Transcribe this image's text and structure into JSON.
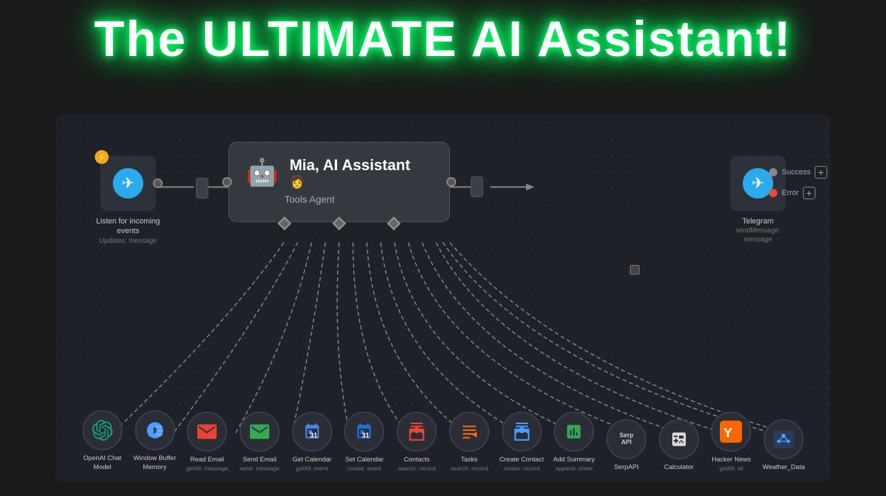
{
  "page": {
    "title": "The ULTIMATE AI Assistant!",
    "background_color": "#1a1a1a"
  },
  "canvas": {
    "background_color": "#1e2128"
  },
  "nodes": {
    "telegram_listen": {
      "label": "Listen for incoming events",
      "sublabel": "Updates: message"
    },
    "ai_agent": {
      "title": "Mia, AI Assistant",
      "subtitle": "Tools Agent",
      "type": "agent"
    },
    "telegram_send": {
      "label": "Telegram",
      "sublabel": "sendMessage: message"
    }
  },
  "tools": [
    {
      "id": "openai",
      "label": "OpenAI Chat Model",
      "sublabel": "",
      "icon": "openai"
    },
    {
      "id": "window_buffer",
      "label": "Window Buffer Memory",
      "sublabel": "",
      "icon": "db"
    },
    {
      "id": "read_email",
      "label": "Read Email",
      "sublabel": "getAll: message",
      "icon": "gmail_read"
    },
    {
      "id": "send_email",
      "label": "Send Email",
      "sublabel": "send: message",
      "icon": "gmail_send"
    },
    {
      "id": "get_calendar",
      "label": "Get Calendar",
      "sublabel": "getAll: event",
      "icon": "calendar"
    },
    {
      "id": "set_calendar",
      "label": "Set Calendar",
      "sublabel": "create: event",
      "icon": "calendar2"
    },
    {
      "id": "contacts",
      "label": "Contacts",
      "sublabel": "search: record",
      "icon": "contacts"
    },
    {
      "id": "tasks",
      "label": "Tasks",
      "sublabel": "search: record",
      "icon": "tasks"
    },
    {
      "id": "create_contact",
      "label": "Create Contact",
      "sublabel": "create: record",
      "icon": "create_contact"
    },
    {
      "id": "add_summary",
      "label": "Add Summary",
      "sublabel": "append: sheet",
      "icon": "sheets"
    },
    {
      "id": "serpapi",
      "label": "SerpAPI",
      "sublabel": "",
      "icon": "serp"
    },
    {
      "id": "calculator",
      "label": "Calculator",
      "sublabel": "",
      "icon": "calc"
    },
    {
      "id": "hacker_news",
      "label": "Hacker News",
      "sublabel": "getAll: all",
      "icon": "hacker"
    },
    {
      "id": "weather",
      "label": "Weather_Data",
      "sublabel": "",
      "icon": "weather"
    }
  ],
  "output_labels": {
    "success": "Success",
    "error": "Error"
  },
  "buttons": {
    "success_plus": "+",
    "error_plus": "+"
  }
}
